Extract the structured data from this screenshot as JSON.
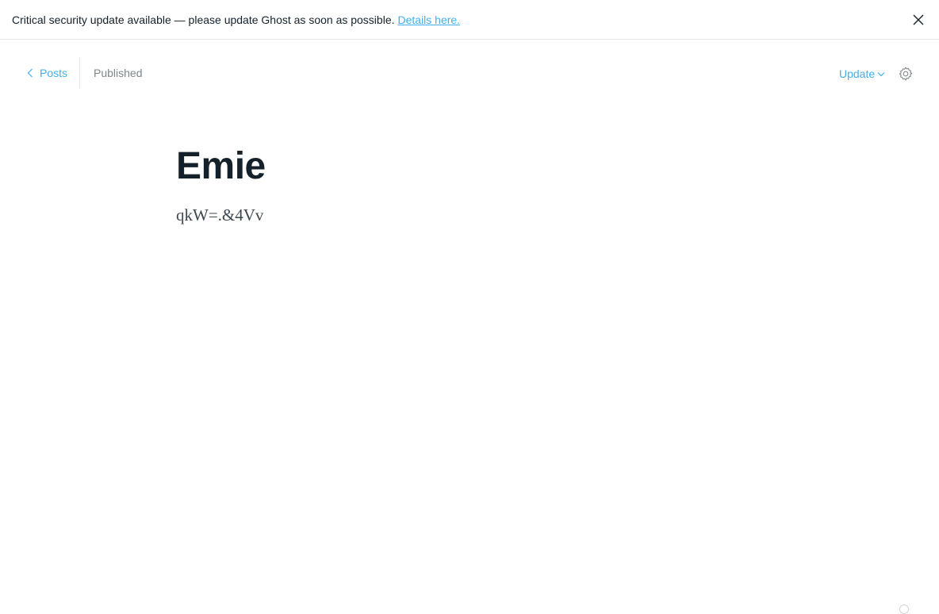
{
  "notice": {
    "message": "Critical security update available — please update Ghost as soon as possible.",
    "link_text": "Details here."
  },
  "header": {
    "back_label": "Posts",
    "status": "Published",
    "update_label": "Update"
  },
  "post": {
    "title": "Emie",
    "body": "qkW=.&4Vv"
  },
  "icons": {
    "close": "close-icon",
    "back": "chevron-left-icon",
    "dropdown": "chevron-down-icon",
    "settings": "gear-icon"
  },
  "colors": {
    "accent": "#3eb0ef",
    "text": "#15212a",
    "muted": "#7d878a"
  }
}
